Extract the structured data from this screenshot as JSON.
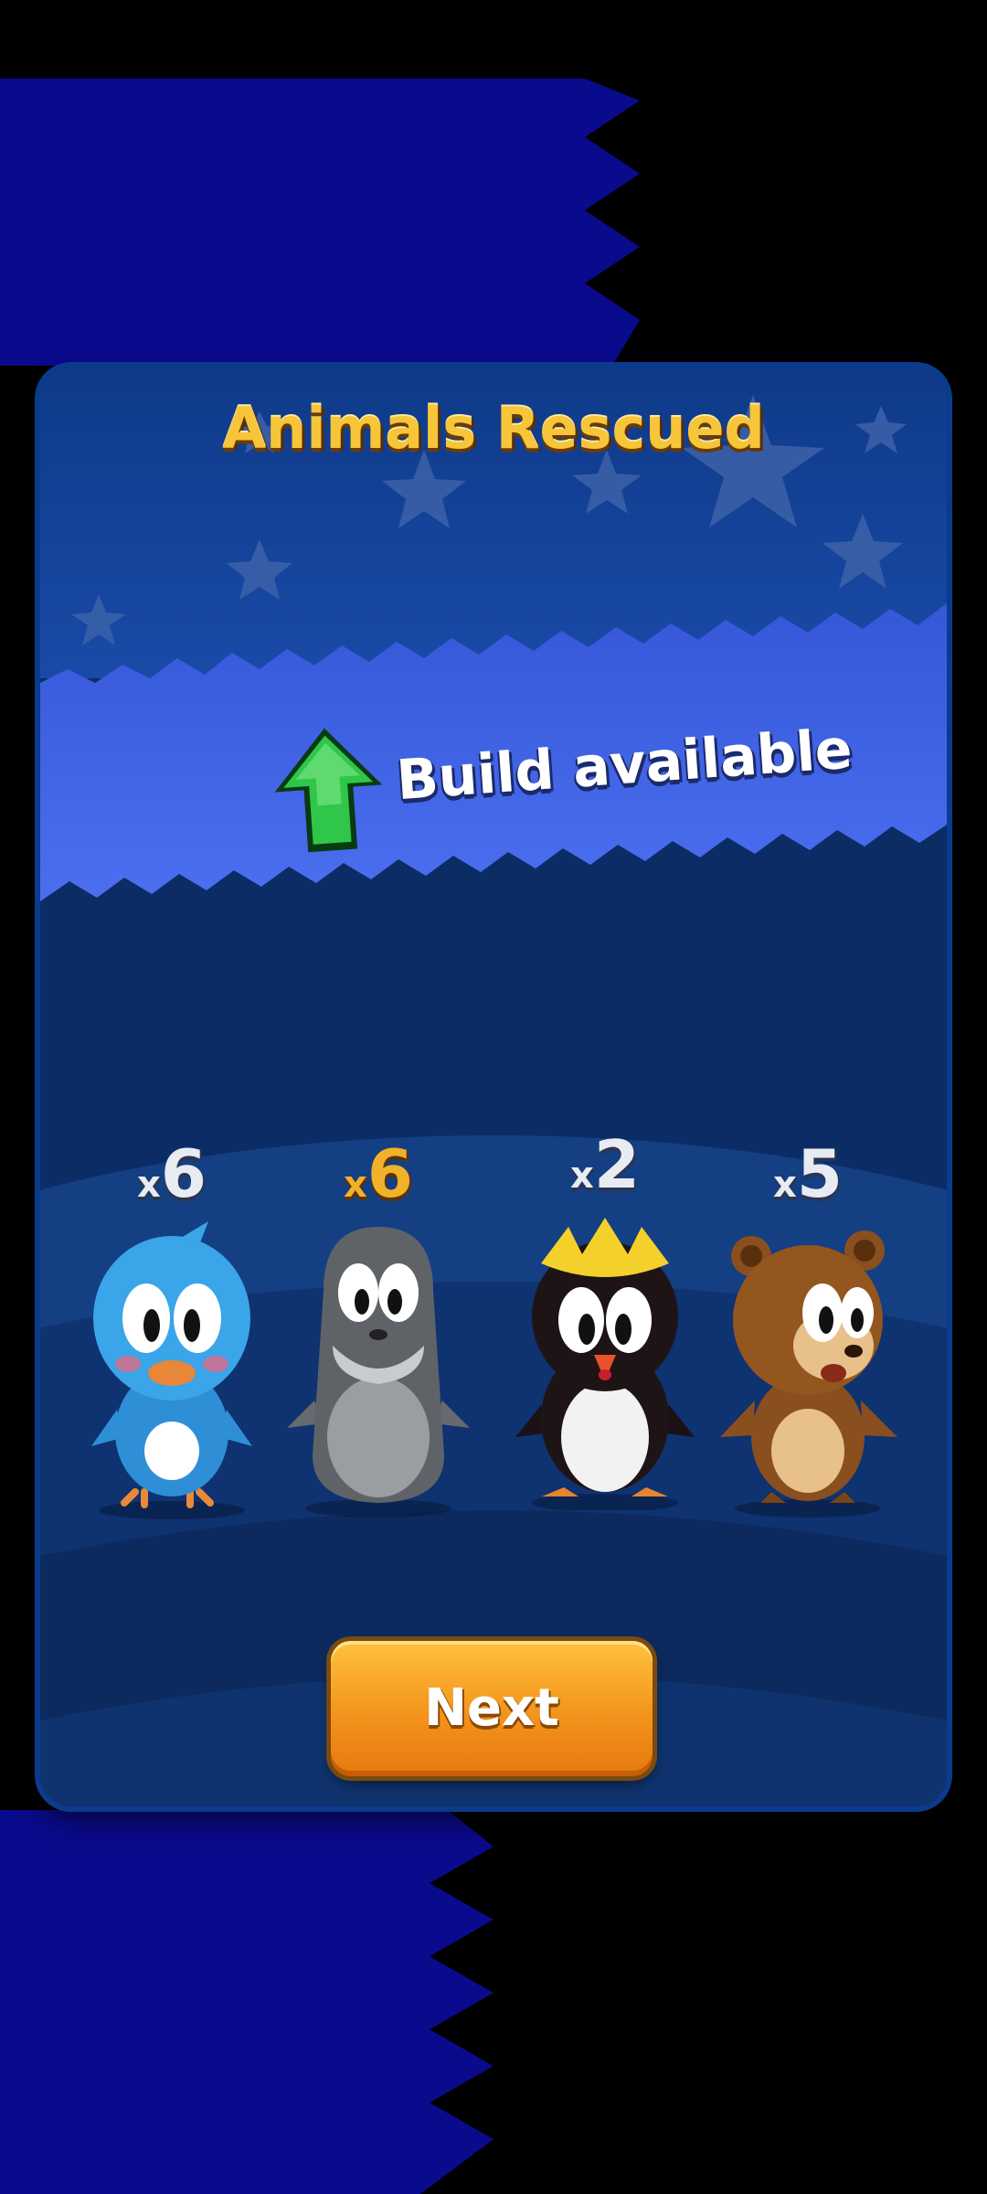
{
  "dialog": {
    "title": "Animals Rescued",
    "build_text": "Build available",
    "next_label": "Next"
  },
  "animals": [
    {
      "name_icon": "bird-icon",
      "count_prefix": "x",
      "count": "6",
      "color": "#3a9fe0"
    },
    {
      "name_icon": "seal-icon",
      "count_prefix": "x",
      "count": "6",
      "color": "#7a7d82"
    },
    {
      "name_icon": "penguin-icon",
      "count_prefix": "x",
      "count": "2",
      "color": "#1e1416"
    },
    {
      "name_icon": "bear-icon",
      "count_prefix": "x",
      "count": "5",
      "color": "#8a4f1e"
    }
  ],
  "colors": {
    "background_blue": "#0a0a8c",
    "panel": "#0d2f6b",
    "banner": "#3f62e6",
    "title_gold": "#f6c53a",
    "button_orange": "#f3931c",
    "arrow_green": "#2fc64a"
  }
}
